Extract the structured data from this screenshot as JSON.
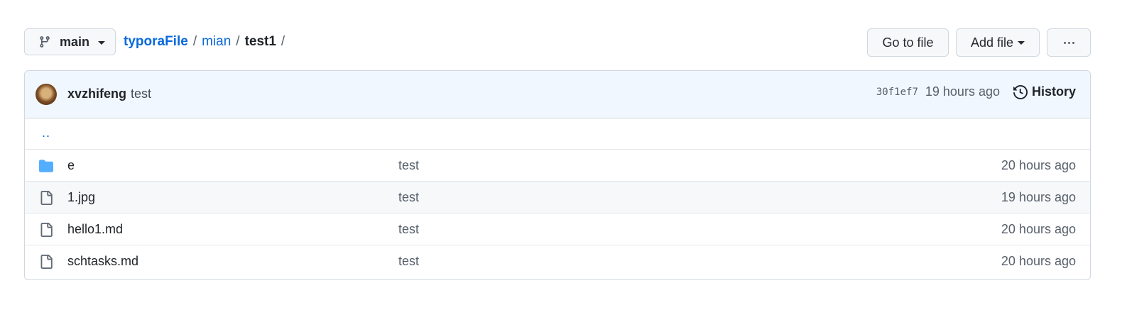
{
  "toolbar": {
    "branch": "main",
    "breadcrumb": {
      "root": "typoraFile",
      "segment1": "mian",
      "current": "test1",
      "separator": "/"
    },
    "go_to_file": "Go to file",
    "add_file": "Add file",
    "more_icon": "kebab-horizontal-icon"
  },
  "commit": {
    "author": "xvzhifeng",
    "message": "test",
    "sha": "30f1ef7",
    "time": "19 hours ago",
    "history_label": "History"
  },
  "parent_dir": "..",
  "files": [
    {
      "type": "folder",
      "icon": "folder-icon",
      "name": "e",
      "message": "test",
      "age": "20 hours ago"
    },
    {
      "type": "file",
      "icon": "file-icon",
      "name": "1.jpg",
      "message": "test",
      "age": "19 hours ago"
    },
    {
      "type": "file",
      "icon": "file-icon",
      "name": "hello1.md",
      "message": "test",
      "age": "20 hours ago"
    },
    {
      "type": "file",
      "icon": "file-icon",
      "name": "schtasks.md",
      "message": "test",
      "age": "20 hours ago"
    }
  ],
  "colors": {
    "accent": "#0969da",
    "folder": "#54aeff",
    "commit_bar_bg": "#f1f7ff",
    "hover_row_bg": "#f6f8fa"
  }
}
